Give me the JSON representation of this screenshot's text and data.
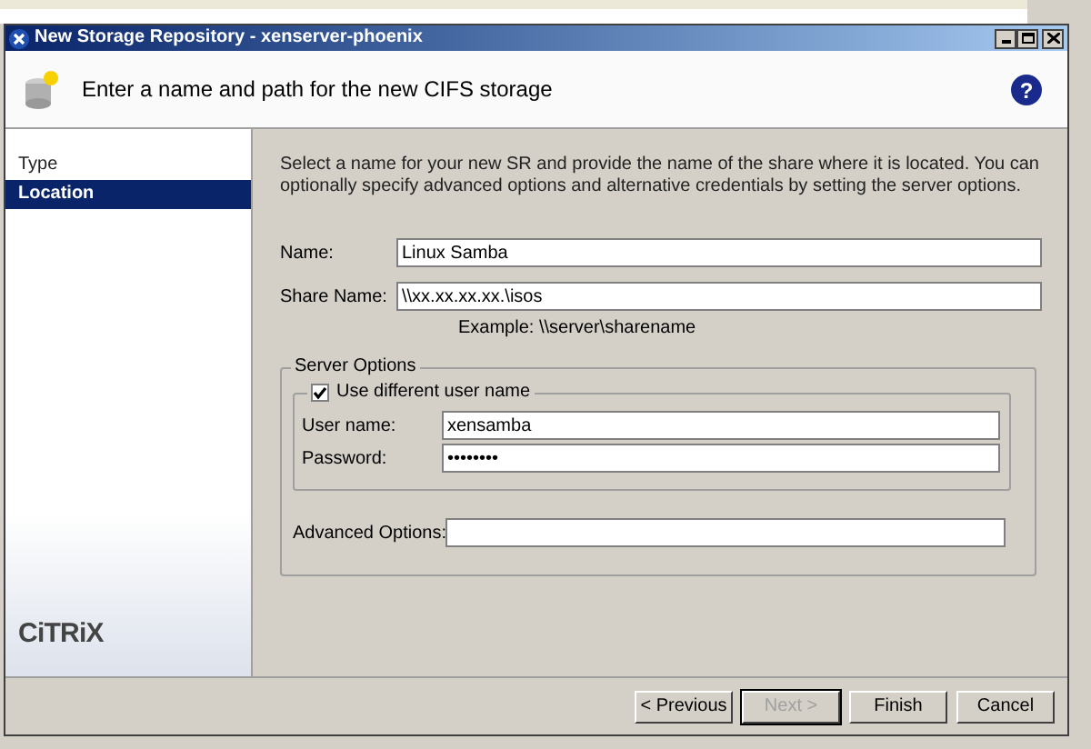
{
  "window": {
    "title": "New Storage Repository - xenserver-phoenix"
  },
  "header": {
    "title": "Enter a name and path for the new CIFS storage",
    "help": "?"
  },
  "sidebar": {
    "items": [
      {
        "label": "Type",
        "selected": false
      },
      {
        "label": "Location",
        "selected": true
      }
    ],
    "logo": "CiTRiX"
  },
  "intro": "Select a name for your new SR and provide the name of the share where it is located. You can optionally specify advanced options and alternative credentials by setting the server options.",
  "name_field": {
    "label": "Name:",
    "value": "Linux Samba"
  },
  "share_field": {
    "label": "Share Name:",
    "value": "\\\\xx.xx.xx.xx.\\isos",
    "example": "Example: \\\\server\\sharename"
  },
  "server_options": {
    "title": "Server Options",
    "use_different_user": {
      "label": "Use different user name",
      "checked": true
    },
    "user_name": {
      "label": "User name:",
      "value": "xensamba"
    },
    "password": {
      "label": "Password:",
      "value": "••••••••"
    }
  },
  "advanced_options": {
    "label": "Advanced Options:"
  },
  "buttons": [
    {
      "label": "< Previous",
      "disabled": false,
      "focused": false
    },
    {
      "label": "Next >",
      "disabled": true,
      "focused": true
    },
    {
      "label": "Finish",
      "disabled": false,
      "focused": false
    },
    {
      "label": "Cancel",
      "disabled": false,
      "focused": false
    }
  ]
}
